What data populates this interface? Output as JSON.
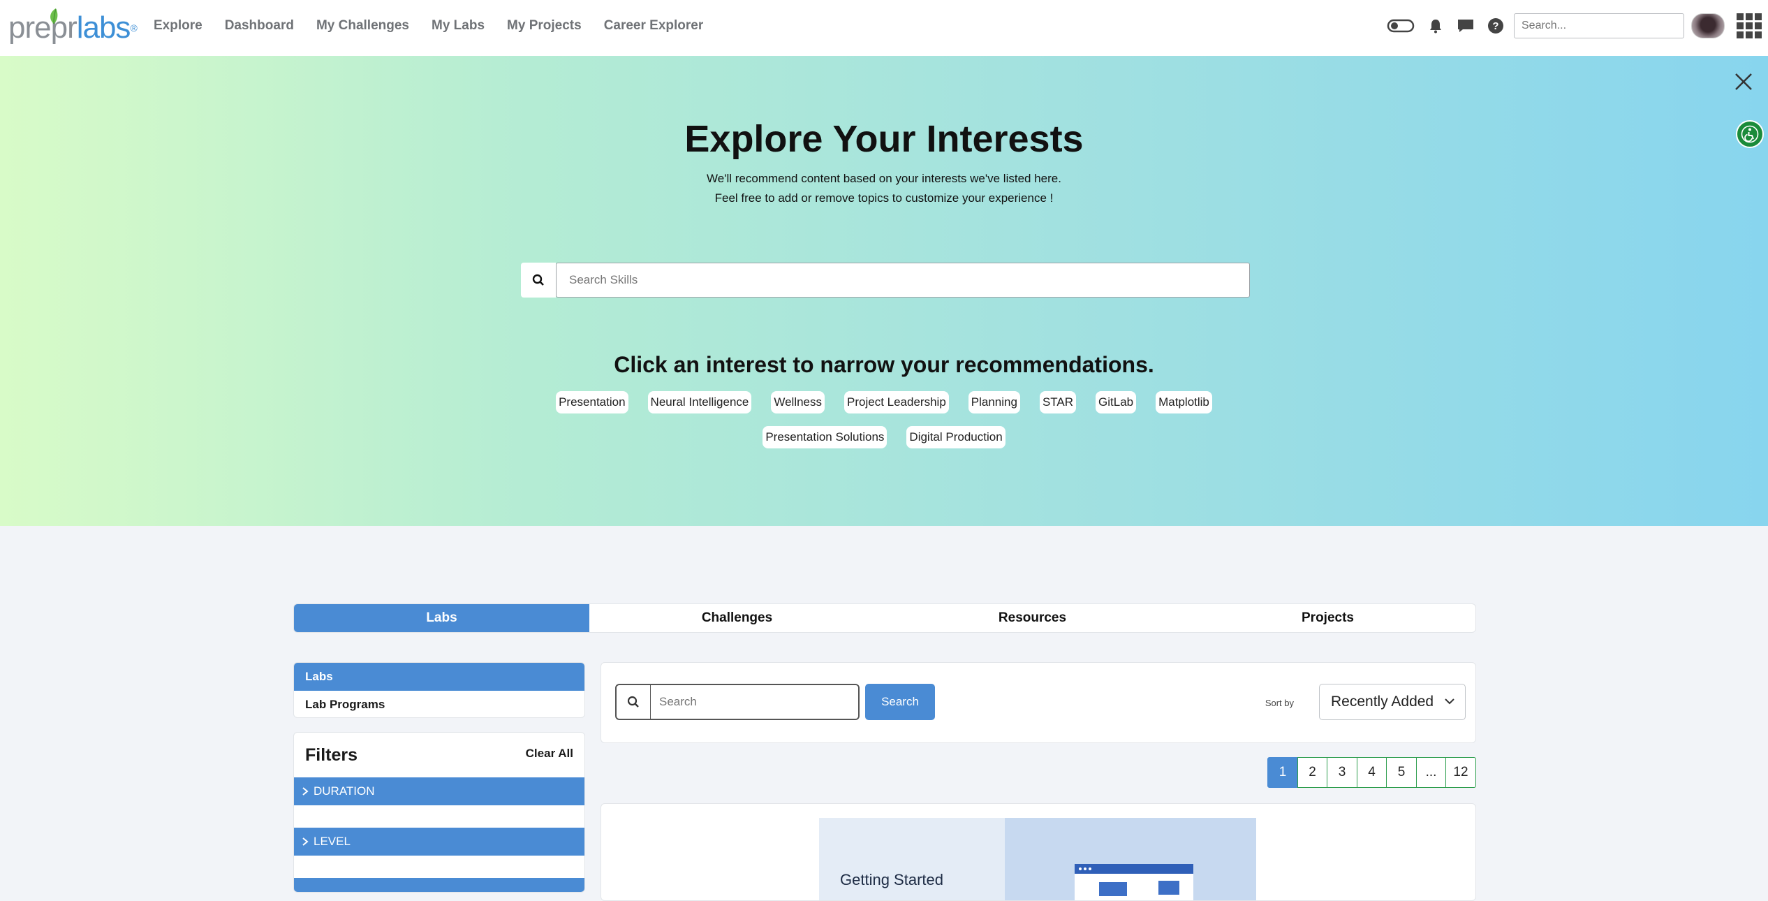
{
  "brand": {
    "part1": "prepr",
    "part2": "labs",
    "mark": "®"
  },
  "nav": {
    "links": [
      "Explore",
      "Dashboard",
      "My Challenges",
      "My Labs",
      "My Projects",
      "Career Explorer"
    ],
    "search_placeholder": "Search..."
  },
  "hero": {
    "title": "Explore Your Interests",
    "subtitle_line1": "We'll recommend content based on your interests we've listed here.",
    "subtitle_line2": "Feel free to add or remove topics to customize your experience !",
    "skill_search_placeholder": "Search Skills",
    "interests_title": "Click an interest to narrow your recommendations.",
    "interests": [
      "Presentation",
      "Neural Intelligence",
      "Wellness",
      "Project Leadership",
      "Planning",
      "STAR",
      "GitLab",
      "Matplotlib",
      "Presentation Solutions",
      "Digital Production"
    ]
  },
  "tabs": [
    "Labs",
    "Challenges",
    "Resources",
    "Projects"
  ],
  "side_menu": [
    "Labs",
    "Lab Programs"
  ],
  "filters": {
    "title": "Filters",
    "clear_label": "Clear All",
    "groups": [
      "DURATION",
      "LEVEL"
    ]
  },
  "lab_search": {
    "placeholder": "Search",
    "button_label": "Search",
    "sort_label": "Sort by",
    "sort_value": "Recently Added"
  },
  "pagination": [
    "1",
    "2",
    "3",
    "4",
    "5",
    "...",
    "12"
  ],
  "card": {
    "caption": "Getting Started"
  },
  "colors": {
    "accent": "#4a8bd4",
    "page_border": "#2e9e4e",
    "access_green": "#1a8b3a"
  }
}
